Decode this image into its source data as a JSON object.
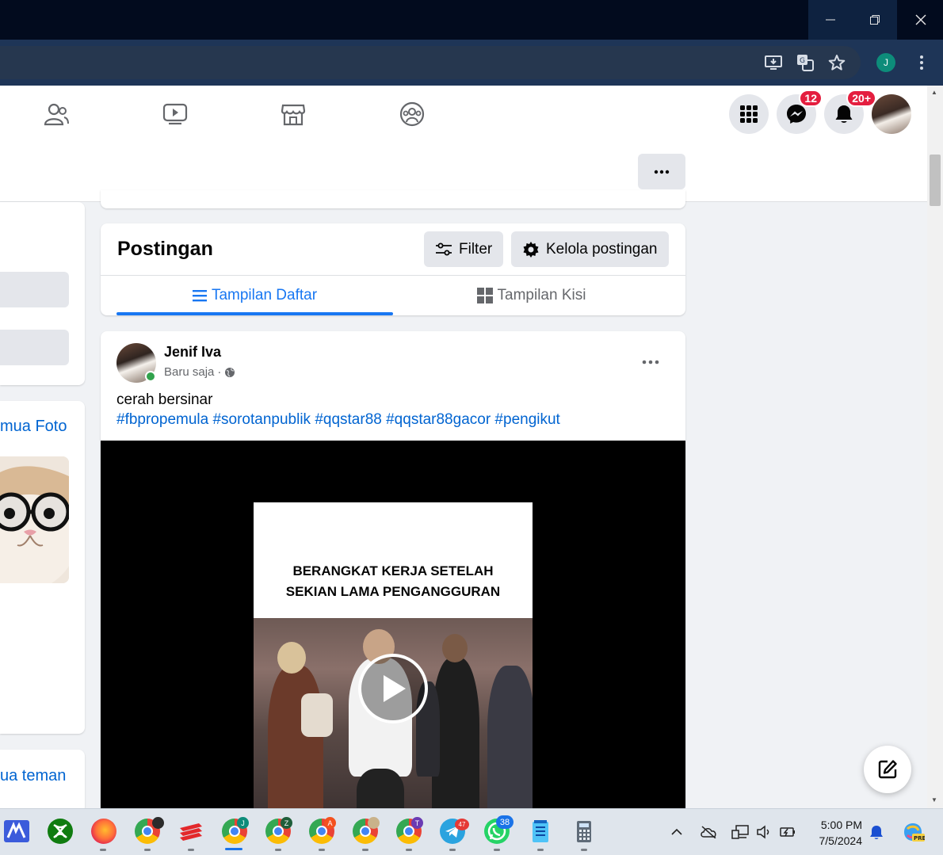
{
  "header": {
    "messenger_badge": "12",
    "notifications_badge": "20+",
    "more_label": "..."
  },
  "left": {
    "photos_link": "mua Foto",
    "friends_link": "ua teman"
  },
  "posts": {
    "title": "Postingan",
    "filter_label": "Filter",
    "manage_label": "Kelola postingan",
    "list_view_label": "Tampilan Daftar",
    "grid_view_label": "Tampilan Kisi"
  },
  "post": {
    "author": "Jenif Iva",
    "time": "Baru saja",
    "separator": "·",
    "text": "cerah bersinar",
    "hashtags": "#fbpropemula #sorotanpublik #qqstar88 #qqstar88gacor #pengikut",
    "video_caption_line1": "BERANGKAT KERJA SETELAH",
    "video_caption_line2": "SEKIAN LAMA PENGANGGURAN"
  },
  "browser": {
    "profile_initial": "J"
  },
  "taskbar": {
    "time": "5:00 PM",
    "date": "7/5/2024",
    "badges": {
      "chrome_j": "J",
      "chrome_z": "Z",
      "chrome_a": "A",
      "chrome_t": "T",
      "telegram": "47",
      "whatsapp": "38"
    }
  },
  "colors": {
    "accent": "#1877f2",
    "link": "#0064d1",
    "badge": "#e41e3f",
    "online": "#31a24c"
  }
}
